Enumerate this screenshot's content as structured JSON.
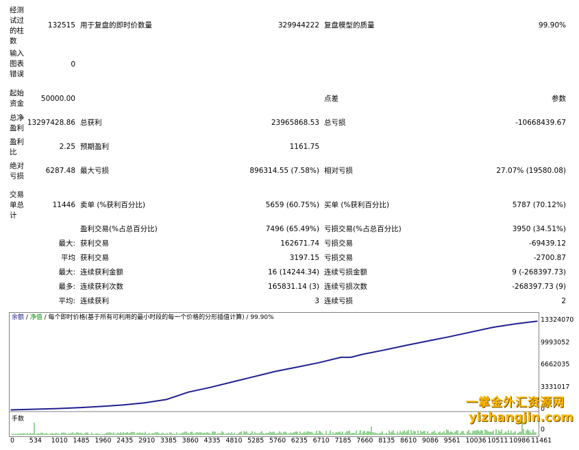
{
  "report": {
    "row1": {
      "label": "经测试过的柱数",
      "value": "132515",
      "label2": "用于复盘的即时价数量",
      "value2": "329944222",
      "label3": "复盘模型的质量",
      "value3": "99.90%"
    },
    "row2": {
      "label": "输入图表错误",
      "value": "0"
    },
    "row3": {
      "label": "起始资金",
      "value": "50000.00",
      "label3": "点差",
      "value3": "参数"
    },
    "row4": {
      "label": "总净盈利",
      "value": "13297428.86",
      "label2": "总获利",
      "value2": "23965868.53",
      "label3": "总亏损",
      "value3": "-10668439.67"
    },
    "row5": {
      "label": "盈利比",
      "value": "2.25",
      "label2": "预期盈利",
      "value2": "1161.75"
    },
    "row6": {
      "label": "绝对亏损",
      "value": "6287.48",
      "label2": "最大亏损",
      "value2": "896314.55 (7.58%)",
      "label3": "相对亏损",
      "value3": "27.07% (19580.08)"
    },
    "row7": {
      "label": "交易单总计",
      "value": "11446",
      "label2": "卖单 (%获利百分比)",
      "value2": "5659 (60.75%)",
      "label3": "买单 (%获利百分比)",
      "value3": "5787 (70.12%)"
    },
    "row8": {
      "label2": "盈利交易(%占总百分比)",
      "value2": "7496 (65.49%)",
      "label3": "亏损交易(%占总百分比)",
      "value3": "3950 (34.51%)"
    },
    "row9": {
      "prefix": "最大:",
      "label2": "获利交易",
      "value2": "162671.74",
      "label3": "亏损交易",
      "value3": "-69439.12"
    },
    "row10": {
      "prefix": "平均",
      "label2": "获利交易",
      "value2": "3197.15",
      "label3": "亏损交易",
      "value3": "-2700.87"
    },
    "row11": {
      "prefix": "最大:",
      "label2": "连续获利金额",
      "value2": "16 (14244.34)",
      "label3": "连续亏损金额",
      "value3": "9 (-268397.73)"
    },
    "row12": {
      "prefix": "最多:",
      "label2": "连续获利次数",
      "value2": "165831.14 (3)",
      "label3": "连续亏损次数",
      "value3": "-268397.73 (9)"
    },
    "row13": {
      "prefix": "平均:",
      "label2": "连续获利",
      "value2": "3",
      "label3": "连续亏损",
      "value3": "2"
    }
  },
  "chart": {
    "legend_balance": "余额",
    "legend_sep1": " / ",
    "legend_equity": "净值",
    "legend_rest": " / 每个即时价格(基于所有可利用的最小时段的每一个价格的分形插值计算) / 99.90%",
    "volume_label": "手数",
    "volume_zero": "0",
    "colors": {
      "balance": "#1f1f8f",
      "volume": "#2aa52a"
    }
  },
  "chart_data": {
    "type": "line",
    "title": "",
    "xlabel": "",
    "ylabel": "",
    "x_ticks": [
      "0",
      "534",
      "1010",
      "1485",
      "1960",
      "2435",
      "2910",
      "3385",
      "3860",
      "4335",
      "4810",
      "5285",
      "5760",
      "6235",
      "6710",
      "7185",
      "7660",
      "8135",
      "8610",
      "9086",
      "9561",
      "10036",
      "10511",
      "10986",
      "11461"
    ],
    "y_ticks": [
      "13324070",
      "9993052",
      "6662035",
      "3331017",
      "0"
    ],
    "ylim": [
      0,
      13324070
    ],
    "xlim": [
      0,
      11446
    ],
    "series": [
      {
        "name": "余额",
        "x": [
          0,
          534,
          1010,
          1485,
          1960,
          2435,
          2910,
          3385,
          3860,
          4335,
          4810,
          5285,
          5760,
          6235,
          6710,
          7185,
          7400,
          7660,
          8135,
          8610,
          9086,
          9561,
          10036,
          10511,
          10986,
          11461
        ],
        "values": [
          50000,
          150000,
          250000,
          380000,
          560000,
          780000,
          1100000,
          1600000,
          2700000,
          3400000,
          4200000,
          5000000,
          5800000,
          6450000,
          7100000,
          7900000,
          7900000,
          8350000,
          9000000,
          9700000,
          10350000,
          11000000,
          11700000,
          12400000,
          12900000,
          13297429
        ]
      }
    ]
  },
  "watermark": {
    "line1": "一掌金外汇资源网",
    "line2": "yizhangjin.com"
  }
}
